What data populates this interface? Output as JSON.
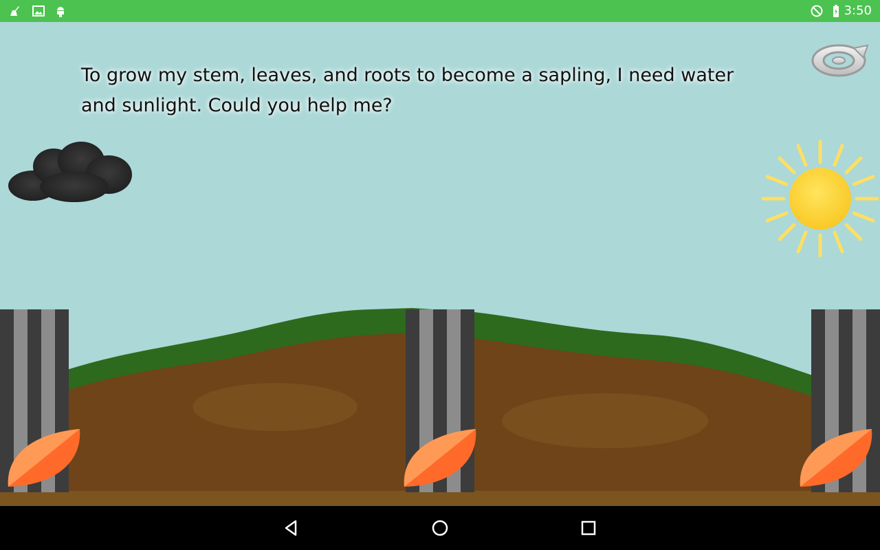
{
  "status_bar": {
    "time": "3:50",
    "left_icons": [
      "cleaner-icon",
      "image-icon",
      "android-icon"
    ],
    "right_icons": [
      "do-not-disturb-icon",
      "battery-charging-icon"
    ],
    "color": "#4cc250"
  },
  "scene": {
    "narration_line1": "To grow my stem, leaves, and roots to become a sapling, I need water",
    "narration_line2": "and sunlight.  Could you help me?",
    "sky_color": "#acd8d8",
    "cloud_color": "#3a3a3a",
    "sun_color": "#ffd84a",
    "grass_color": "#2d6a1e",
    "soil_color": "#6e4418",
    "leaf_color": "#ff6a2a"
  },
  "nav_bar": {
    "buttons": [
      "back-icon",
      "home-icon",
      "recents-icon"
    ]
  }
}
